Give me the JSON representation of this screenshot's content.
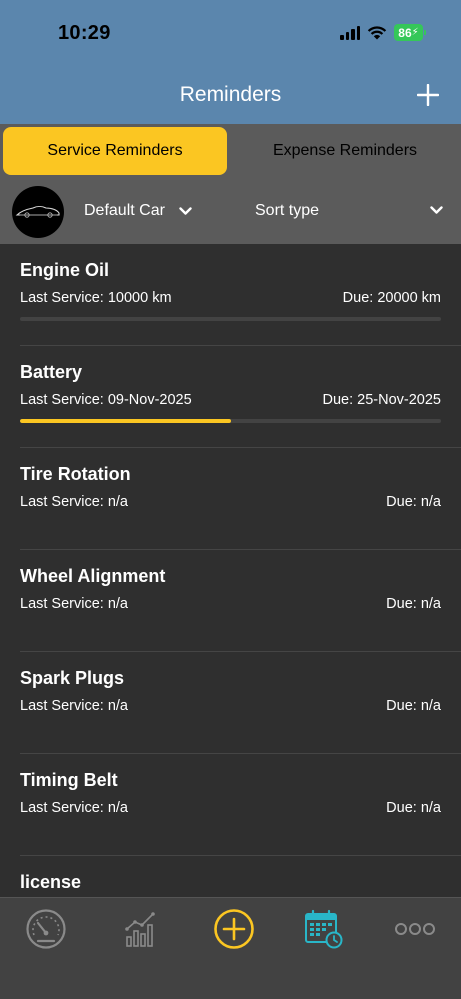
{
  "status_bar": {
    "time": "10:29",
    "battery_level": "86"
  },
  "header": {
    "title": "Reminders",
    "add_icon": "plus-icon"
  },
  "tabs": [
    {
      "label": "Service Reminders",
      "selected": true
    },
    {
      "label": "Expense Reminders",
      "selected": false
    }
  ],
  "filters": {
    "car_label": "Default Car",
    "sort_label": "Sort type"
  },
  "reminders": [
    {
      "title": "Engine Oil",
      "last_service": "Last Service: 10000 km",
      "due": "Due: 20000 km",
      "progress": 0.0,
      "show_progress": true
    },
    {
      "title": "Battery",
      "last_service": "Last Service: 09-Nov-2025",
      "due": "Due: 25-Nov-2025",
      "progress": 0.5,
      "show_progress": true
    },
    {
      "title": "Tire Rotation",
      "last_service": "Last Service: n/a",
      "due": "Due: n/a",
      "show_progress": false
    },
    {
      "title": "Wheel Alignment",
      "last_service": "Last Service: n/a",
      "due": "Due: n/a",
      "show_progress": false
    },
    {
      "title": "Spark Plugs",
      "last_service": "Last Service: n/a",
      "due": "Due: n/a",
      "show_progress": false
    },
    {
      "title": "Timing Belt",
      "last_service": "Last Service: n/a",
      "due": "Due: n/a",
      "show_progress": false
    },
    {
      "title": "license",
      "last_service": "",
      "due": "",
      "show_progress": false
    }
  ],
  "tab_bar": [
    {
      "icon": "speedometer-icon",
      "active": false
    },
    {
      "icon": "bar-chart-icon",
      "active": false
    },
    {
      "icon": "add-circle-icon",
      "active": false
    },
    {
      "icon": "calendar-icon",
      "active": true
    },
    {
      "icon": "more-icon",
      "active": false
    }
  ],
  "colors": {
    "header_bg": "#5b86ad",
    "accent": "#fbc622",
    "active_tab": "#29b6c8",
    "background": "#2f2f2f"
  }
}
